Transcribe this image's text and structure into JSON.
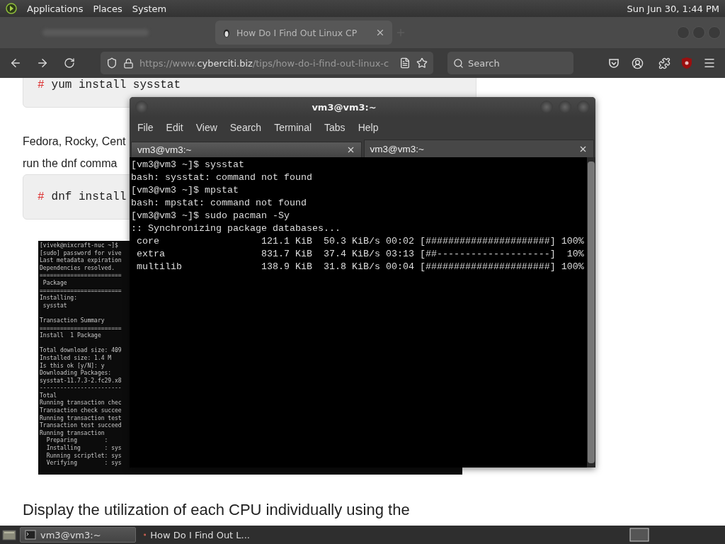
{
  "top_panel": {
    "menus": [
      "Applications",
      "Places",
      "System"
    ],
    "clock": "Sun Jun 30, 1:44 PM"
  },
  "browser": {
    "tabs": [
      {
        "kind": "blurred",
        "selected": false
      },
      {
        "kind": "page",
        "title": "How Do I Find Out Linux CP",
        "selected": true
      }
    ],
    "url": {
      "prefix": "https://www.",
      "domain": "cyberciti.biz",
      "path": "/tips/how-do-i-find-out-linux-c"
    },
    "search": {
      "placeholder": "Search"
    }
  },
  "page": {
    "blocks": [
      {
        "kind": "code",
        "prompt": "#",
        "command": "yum install sysstat"
      },
      {
        "kind": "paragraph",
        "lines": [
          "Fedora, Rocky, Cent",
          "run the dnf comma"
        ]
      },
      {
        "kind": "code",
        "prompt": "#",
        "command": "dnf install"
      },
      {
        "kind": "screenshot",
        "groups": [
          [
            "[vivek@nixcraft-nuc ~]$",
            "[sudo] password for vive",
            "Last metadata expiration",
            "Dependencies resolved.",
            "========================",
            " Package",
            "========================",
            "Installing:",
            " sysstat"
          ],
          [
            "Transaction Summary",
            "========================",
            "Install  1 Package"
          ],
          [
            "Total download size: 409",
            "Installed size: 1.4 M",
            "Is this ok [y/N]: y",
            "Downloading Packages:",
            "sysstat-11.7.3-2.fc29.x8",
            "------------------------",
            "Total",
            "Running transaction chec",
            "Transaction check succee",
            "Running transaction test",
            "Transaction test succeed",
            "Running transaction",
            "  Preparing        :",
            "  Installing       : sys",
            "  Running scriptlet: sys",
            "  Verifying        : sys"
          ]
        ]
      },
      {
        "kind": "heading",
        "text": "Display the utilization of each CPU individually using the"
      }
    ]
  },
  "terminal": {
    "title": "vm3@vm3:~",
    "menu": [
      "File",
      "Edit",
      "View",
      "Search",
      "Terminal",
      "Tabs",
      "Help"
    ],
    "tabs": [
      {
        "title": "vm3@vm3:~",
        "selected": false
      },
      {
        "title": "vm3@vm3:~",
        "selected": true
      }
    ],
    "lines": [
      "[vm3@vm3 ~]$ sysstat",
      "bash: sysstat: command not found",
      "[vm3@vm3 ~]$ mpstat",
      "bash: mpstat: command not found",
      "[vm3@vm3 ~]$ sudo pacman -Sy",
      ":: Synchronizing package databases...",
      " core                  121.1 KiB  50.3 KiB/s 00:02 [######################] 100%",
      " extra                 831.7 KiB  37.4 KiB/s 03:13 [##--------------------]  10%",
      " multilib              138.9 KiB  31.8 KiB/s 00:04 [######################] 100%"
    ]
  },
  "taskbar": {
    "tasks": [
      {
        "kind": "terminal",
        "title": "vm3@vm3:~",
        "selected": true
      },
      {
        "kind": "browser",
        "title": "How Do I Find Out L...",
        "selected": false
      }
    ]
  }
}
